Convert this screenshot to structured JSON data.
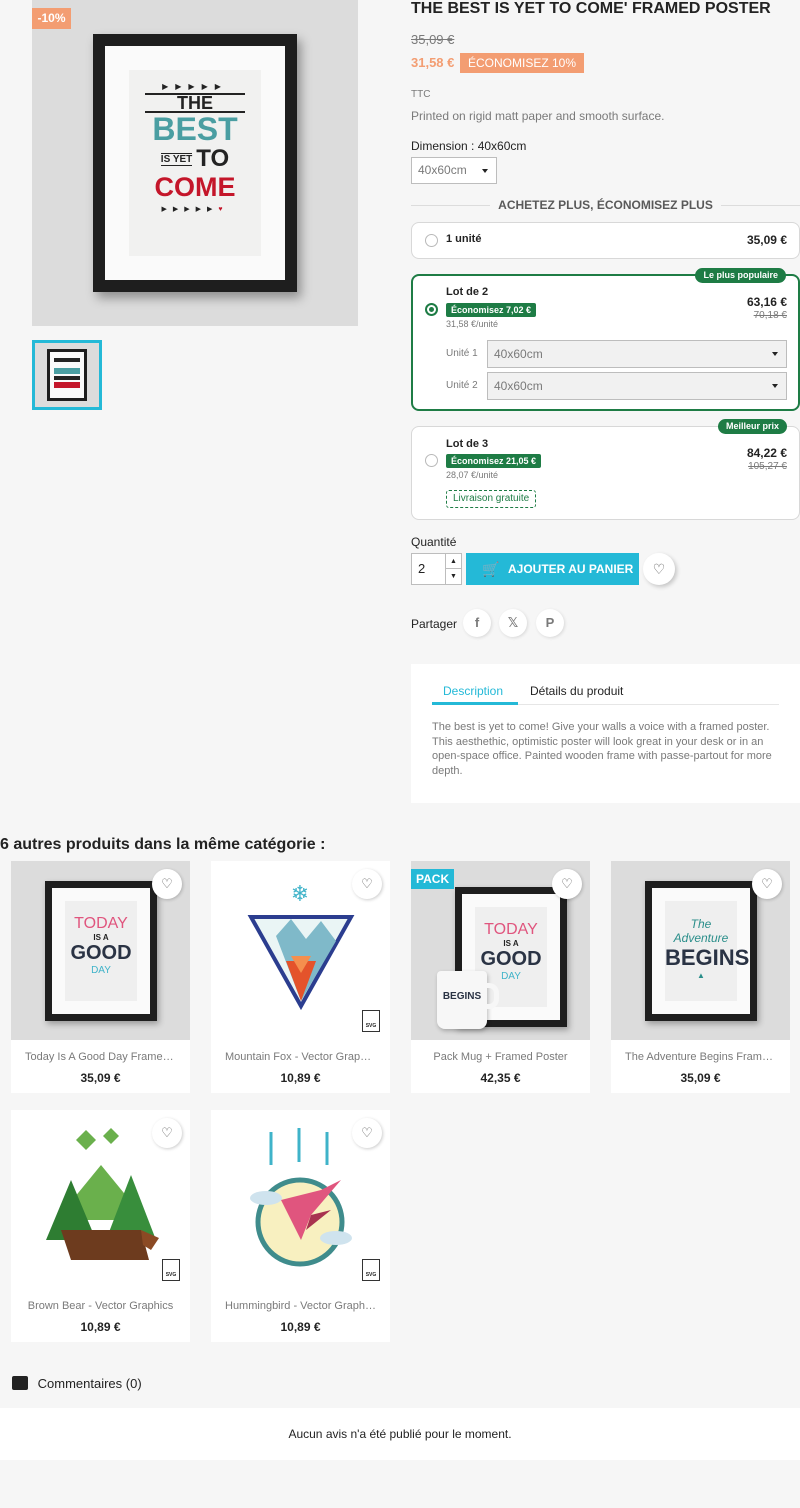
{
  "product": {
    "title": "THE BEST IS YET TO COME' FRAMED POSTER",
    "discount_flag": "-10%",
    "old_price": "35,09 €",
    "price": "31,58 €",
    "save_badge": "ÉCONOMISEZ 10%",
    "tax_label": "TTC",
    "short_description": "Printed on rigid matt paper and smooth surface.",
    "dimension_label": "Dimension : 40x60cm",
    "dimension_value": "40x60cm",
    "poster_text": {
      "line1": "THE",
      "line2": "BEST",
      "line3a": "IS YET",
      "line3b": "TO",
      "line4": "COME"
    }
  },
  "bulk": {
    "title": "ACHETEZ PLUS, ÉCONOMISEZ PLUS",
    "offers": [
      {
        "name": "1 unité",
        "price": "35,09 €"
      },
      {
        "name": "Lot de 2",
        "price": "63,16 €",
        "old_price": "70,18 €",
        "save": "Économisez 7,02 €",
        "unit_price": "31,58 €/unité",
        "tag": "Le plus populaire",
        "units": [
          {
            "label": "Unité 1",
            "value": "40x60cm"
          },
          {
            "label": "Unité 2",
            "value": "40x60cm"
          }
        ]
      },
      {
        "name": "Lot de 3",
        "price": "84,22 €",
        "old_price": "105,27 €",
        "save": "Économisez 21,05 €",
        "unit_price": "28,07 €/unité",
        "tag": "Meilleur prix",
        "shipping": "Livraison gratuite"
      }
    ]
  },
  "cart": {
    "quantity_label": "Quantité",
    "quantity": "2",
    "add_to_cart": "AJOUTER AU PANIER"
  },
  "share": {
    "label": "Partager",
    "facebook": "f",
    "x": "𝕏",
    "pinterest": "P"
  },
  "tabs": {
    "description": "Description",
    "details": "Détails du produit",
    "text": "The best is yet to come! Give your walls a voice with a framed poster. This aesthethic, optimistic poster will look great in your desk or in an open-space office. Painted wooden frame with passe-partout for more depth."
  },
  "related": {
    "title": "6 autres produits dans la même catégorie :",
    "items": [
      {
        "name": "Today Is A Good Day Framed...",
        "price": "35,09 €"
      },
      {
        "name": "Mountain Fox - Vector Graphics",
        "price": "10,89 €"
      },
      {
        "name": "Pack Mug + Framed Poster",
        "price": "42,35 €",
        "flag": "PACK"
      },
      {
        "name": "The Adventure Begins Framed...",
        "price": "35,09 €"
      },
      {
        "name": "Brown Bear - Vector Graphics",
        "price": "10,89 €"
      },
      {
        "name": "Hummingbird - Vector Graphics",
        "price": "10,89 €"
      }
    ],
    "svg_badge": "SVG"
  },
  "comments": {
    "label": "Commentaires (0)",
    "empty": "Aucun avis n'a été publié pour le moment."
  },
  "colors": {
    "accent": "#24b9d7",
    "discount": "#f39d72",
    "green": "#1e7c45"
  }
}
